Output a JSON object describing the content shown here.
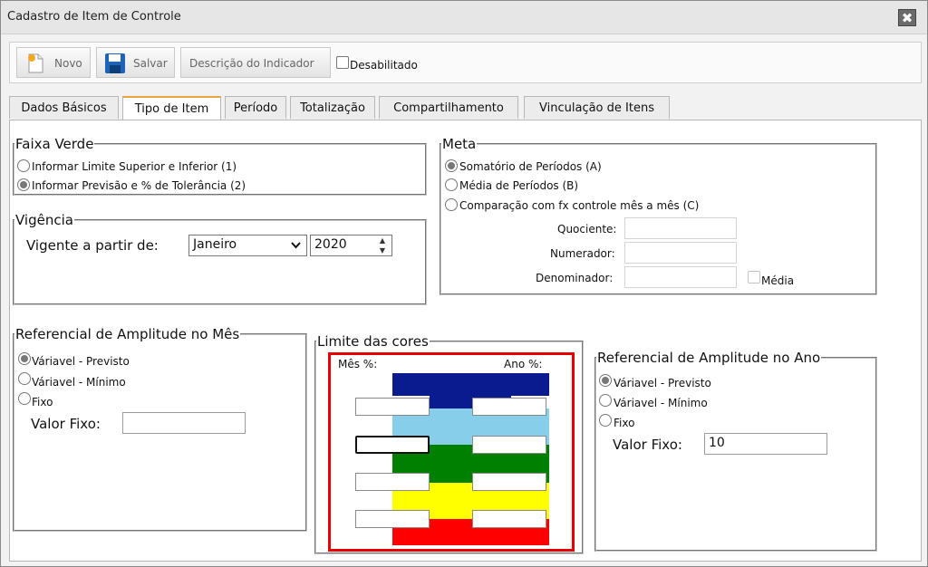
{
  "window": {
    "title": "Cadastro de Item de Controle",
    "close_symbol": "✖"
  },
  "toolbar": {
    "novo": "Novo",
    "salvar": "Salvar",
    "descricao": "Descrição do Indicador",
    "desabilitado": "Desabilitado"
  },
  "tabs": [
    "Dados Básicos",
    "Tipo de Item",
    "Período",
    "Totalização",
    "Compartilhamento",
    "Vinculação de Itens"
  ],
  "active_tab": "Tipo de Item",
  "faixa_verde": {
    "legend": "Faixa Verde",
    "opt1": "Informar Limite Superior e Inferior (1)",
    "opt2": "Informar Previsão e % de Tolerância (2)",
    "selected": 2
  },
  "meta": {
    "legend": "Meta",
    "opt_a": "Somatório de Períodos (A)",
    "opt_b": "Média de Períodos (B)",
    "opt_c": "Comparação com fx controle mês a mês (C)",
    "selected": "A",
    "quociente": "Quociente:",
    "numerador": "Numerador:",
    "denominador": "Denominador:",
    "media": "Média"
  },
  "vigencia": {
    "legend": "Vigência",
    "label": "Vigente a partir de:",
    "month": "Janeiro",
    "year": "2020"
  },
  "ref_mes": {
    "legend": "Referencial de Amplitude no Mês",
    "opt1": "Váriavel - Previsto",
    "opt2": "Váriavel - Mínimo",
    "opt3": "Fixo",
    "selected": 1,
    "valor_label": "Valor Fixo:",
    "valor": ""
  },
  "limite": {
    "legend": "Limite das cores",
    "mes": "Mês %:",
    "ano": "Ano %:",
    "colors": [
      "#0a1a8f",
      "#87ceeb",
      "#008000",
      "#ffff00",
      "#ff0000"
    ]
  },
  "ref_ano": {
    "legend": "Referencial de Amplitude no Ano",
    "opt1": "Váriavel - Previsto",
    "opt2": "Váriavel - Mínimo",
    "opt3": "Fixo",
    "selected": 1,
    "valor_label": "Valor Fixo:",
    "valor": "10"
  },
  "highlight_color": "#e60000"
}
